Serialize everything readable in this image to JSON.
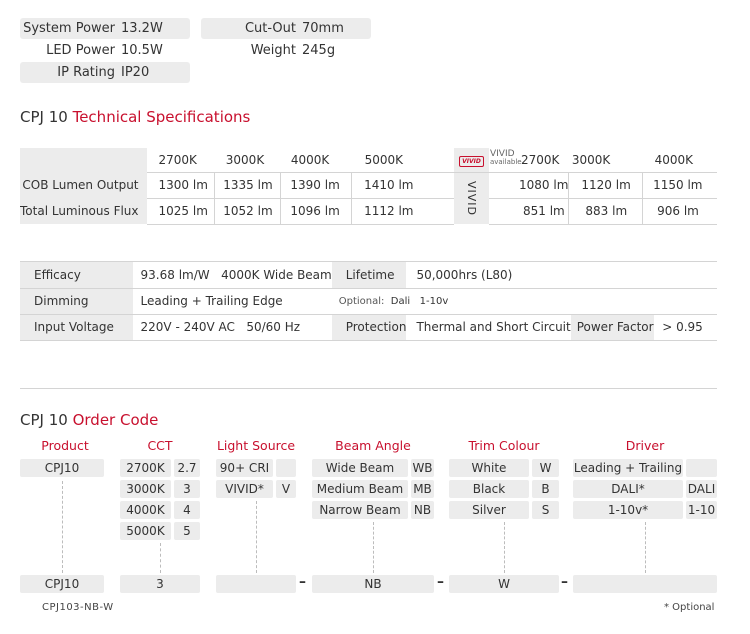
{
  "top_specs": [
    {
      "label": "System Power",
      "value": "13.2W"
    },
    {
      "label": "LED Power",
      "value": "10.5W"
    },
    {
      "label": "IP Rating",
      "value": "IP20"
    },
    {
      "label": "Cut-Out",
      "value": "70mm"
    },
    {
      "label": "Weight",
      "value": "245g"
    }
  ],
  "tech_heading": {
    "model": "CPJ 10",
    "title": "Technical Specifications"
  },
  "lumen_table": {
    "cct_headers": [
      "2700K",
      "3000K",
      "4000K",
      "5000K"
    ],
    "vivid_logo": "VIVID",
    "vivid_label": "VIVID",
    "vivid_available": "available",
    "vivid_vertical": "VIVID",
    "vivid_headers": [
      "2700K",
      "3000K",
      "4000K"
    ],
    "rows": [
      {
        "label": "COB Lumen Output",
        "values": [
          "1300 lm",
          "1335 lm",
          "1390 lm",
          "1410 lm"
        ],
        "vivid_values": [
          "1080 lm",
          "1120 lm",
          "1150 lm"
        ]
      },
      {
        "label": "Total Luminous Flux",
        "values": [
          "1025 lm",
          "1052 lm",
          "1096 lm",
          "1112 lm"
        ],
        "vivid_values": [
          "851 lm",
          "883 lm",
          "906 lm"
        ]
      }
    ]
  },
  "elec_table": {
    "efficacy": {
      "label": "Efficacy",
      "value": "93.68 lm/W",
      "beam": "4000K Wide Beam"
    },
    "lifetime": {
      "label": "Lifetime",
      "value": "50,000hrs (L80)"
    },
    "dimming": {
      "label": "Dimming",
      "value": "Leading + Trailing Edge",
      "optional_label": "Optional:",
      "optional_values": "Dali   1-10v"
    },
    "input_voltage": {
      "label": "Input Voltage",
      "value": "220V - 240V AC   50/60 Hz"
    },
    "protection": {
      "label": "Protection",
      "value": "Thermal and Short Circuit"
    },
    "power_factor": {
      "label": "Power Factor",
      "value": "> 0.95"
    }
  },
  "order_heading": {
    "model": "CPJ 10",
    "title": "Order Code"
  },
  "order_columns": {
    "product": {
      "title": "Product",
      "options": [
        {
          "name": "CPJ10"
        }
      ]
    },
    "cct": {
      "title": "CCT",
      "options": [
        {
          "name": "2700K",
          "code": "2.7"
        },
        {
          "name": "3000K",
          "code": "3"
        },
        {
          "name": "4000K",
          "code": "4"
        },
        {
          "name": "5000K",
          "code": "5"
        }
      ]
    },
    "light_source": {
      "title": "Light Source",
      "options": [
        {
          "name": "90+ CRI",
          "code": ""
        },
        {
          "name": "VIVID*",
          "code": "V"
        }
      ]
    },
    "beam_angle": {
      "title": "Beam Angle",
      "options": [
        {
          "name": "Wide Beam",
          "code": "WB"
        },
        {
          "name": "Medium Beam",
          "code": "MB"
        },
        {
          "name": "Narrow Beam",
          "code": "NB"
        }
      ]
    },
    "trim_colour": {
      "title": "Trim Colour",
      "options": [
        {
          "name": "White",
          "code": "W"
        },
        {
          "name": "Black",
          "code": "B"
        },
        {
          "name": "Silver",
          "code": "S"
        }
      ]
    },
    "driver": {
      "title": "Driver",
      "options": [
        {
          "name": "Leading + Trailing",
          "code": ""
        },
        {
          "name": "DALI*",
          "code": "DALI"
        },
        {
          "name": "1-10v*",
          "code": "1-10"
        }
      ]
    }
  },
  "order_example": {
    "product": "CPJ10",
    "cct": "3",
    "light_source": "",
    "beam_angle": "NB",
    "trim_colour": "W",
    "driver": "",
    "separator": "–",
    "full_code": "CPJ103-NB-W"
  },
  "footnote": "* Optional",
  "colors": {
    "accent": "#c8102e",
    "cell_bg": "#ececec",
    "rule": "#d4d4d4"
  }
}
